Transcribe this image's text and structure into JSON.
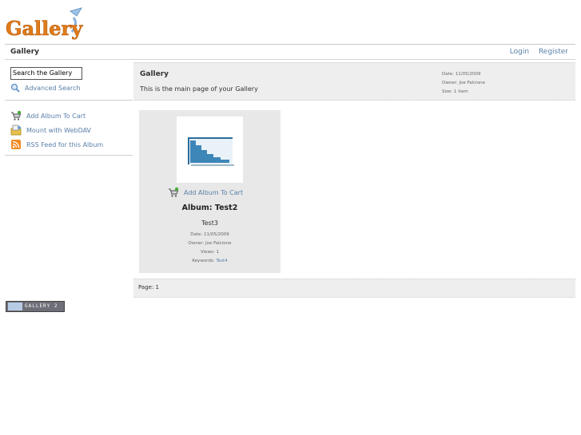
{
  "header": {
    "logo_text": "Gallery",
    "title": "Gallery",
    "login_label": "Login",
    "register_label": "Register"
  },
  "sidebar": {
    "search_value": "Search the Gallery",
    "advanced_search_label": "Advanced Search",
    "items": [
      {
        "label": "Add Album To Cart",
        "icon": "cart-icon"
      },
      {
        "label": "Mount with WebDAV",
        "icon": "webdav-icon"
      },
      {
        "label": "RSS Feed for this Album",
        "icon": "rss-icon"
      }
    ]
  },
  "main": {
    "title": "Gallery",
    "description": "This is the main page of your Gallery",
    "date": "Date: 11/05/2009",
    "owner": "Owner: Joe Falcione",
    "size": "Size: 1 item"
  },
  "album": {
    "cart_label": "Add Album To Cart",
    "title": "Album: Test2",
    "description": "Test3",
    "date": "Date: 11/05/2009",
    "owner": "Owner: Joe Falcione",
    "views": "Views: 1",
    "keywords_label": "Keywords:",
    "keyword": "Test4"
  },
  "pager": {
    "label": "Page:",
    "current": "1"
  },
  "footer": {
    "badge_text": "GALLERY 2"
  },
  "colors": {
    "link": "#5a7fa8",
    "panel_bg": "#eeeeee",
    "logo_orange": "#e07b1a"
  }
}
